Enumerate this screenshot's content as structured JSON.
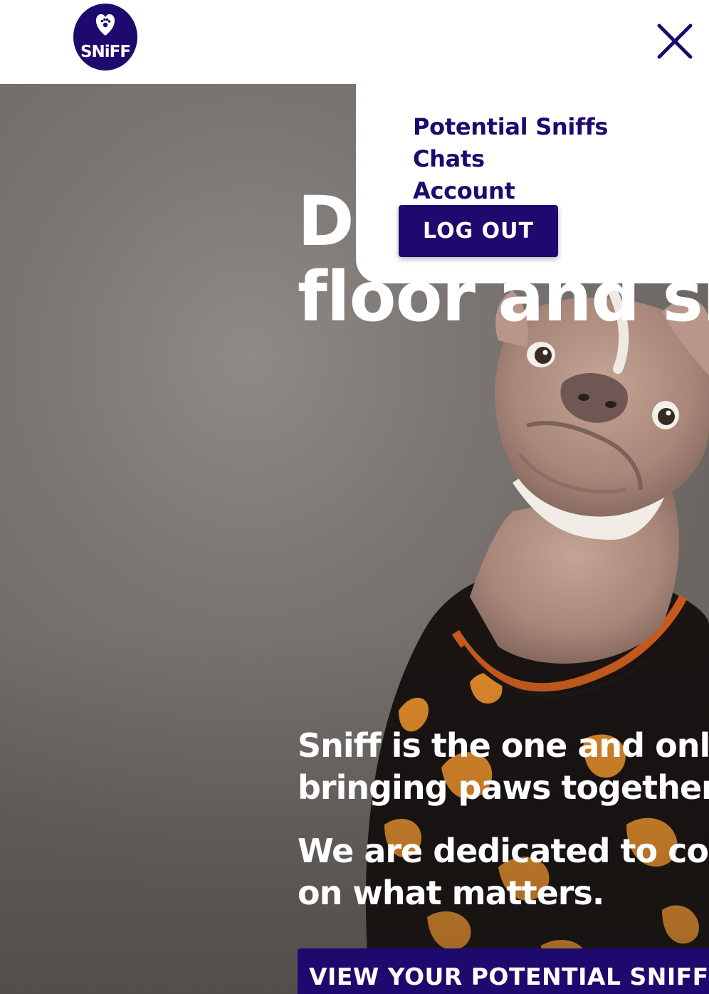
{
  "brand": {
    "logo_text": "SNiFF",
    "primary_color": "#1e0a6e"
  },
  "header": {
    "close_icon": "close-icon"
  },
  "menu": {
    "items": [
      {
        "label": "Potential Sniffs"
      },
      {
        "label": "Chats"
      },
      {
        "label": "Account"
      }
    ],
    "logout_label": "LOG OUT"
  },
  "hero": {
    "title_line1": "Do",
    "title_line2": "floor and sho",
    "paragraph1_line1": "Sniff is the one and only",
    "paragraph1_line2": "bringing paws together.",
    "paragraph2_line1": "We are dedicated to conn",
    "paragraph2_line2": "on what matters.",
    "cta_label": "VIEW YOUR POTENTIAL SNIFFS"
  }
}
